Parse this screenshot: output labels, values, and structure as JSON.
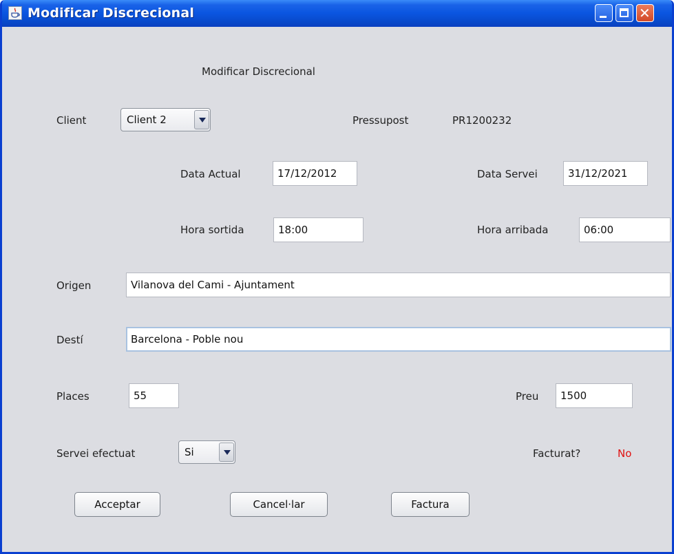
{
  "window": {
    "title": "Modificar Discrecional"
  },
  "form": {
    "heading": "Modificar Discrecional",
    "client": {
      "label": "Client",
      "value": "Client 2"
    },
    "pressupost": {
      "label": "Pressupost",
      "value": "PR1200232"
    },
    "data_actual": {
      "label": "Data Actual",
      "value": "17/12/2012"
    },
    "data_servei": {
      "label": "Data Servei",
      "value": "31/12/2021"
    },
    "hora_sortida": {
      "label": "Hora sortida",
      "value": "18:00"
    },
    "hora_arribada": {
      "label": "Hora arribada",
      "value": "06:00"
    },
    "origen": {
      "label": "Origen",
      "value": "Vilanova del Cami - Ajuntament"
    },
    "desti": {
      "label": "Destí",
      "value": "Barcelona - Poble nou"
    },
    "places": {
      "label": "Places",
      "value": "55"
    },
    "preu": {
      "label": "Preu",
      "value": "1500"
    },
    "servei_efectuat": {
      "label": "Servei efectuat",
      "value": "Si"
    },
    "facturat": {
      "label": "Facturat?",
      "value": "No",
      "value_color": "#e01010"
    }
  },
  "buttons": {
    "accept": "Acceptar",
    "cancel": "Cancel·lar",
    "invoice": "Factura"
  },
  "icons": {
    "app": "java-cup-icon",
    "minimize": "minimize-icon",
    "maximize": "maximize-icon",
    "close": "close-icon"
  }
}
